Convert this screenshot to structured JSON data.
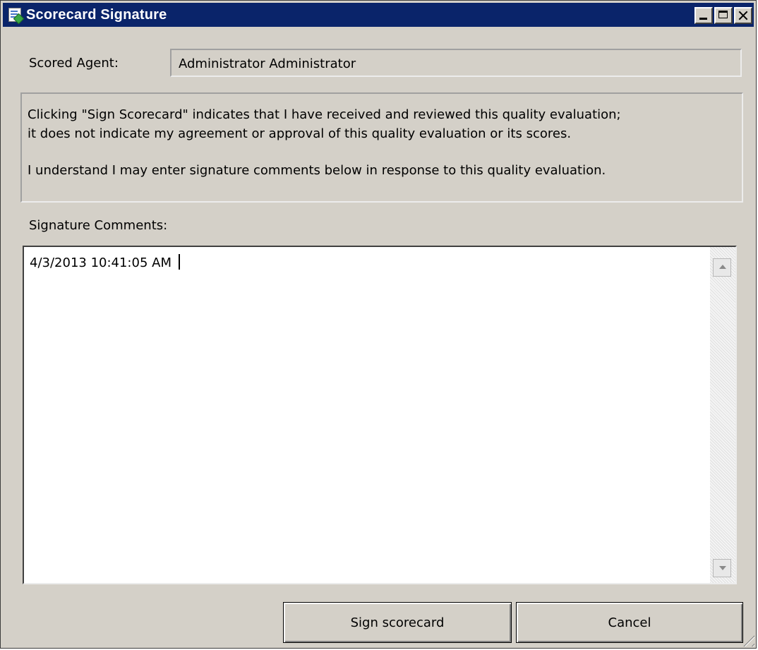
{
  "window": {
    "title": "Scorecard Signature",
    "title_bar_color": "#0a246a",
    "buttons": [
      "minimize-icon",
      "maximize-icon",
      "close-icon"
    ]
  },
  "scored_agent": {
    "label": "Scored Agent:",
    "value": "Administrator Administrator"
  },
  "notice": {
    "paragraph1_line1": "Clicking \"Sign Scorecard\" indicates that I have received and reviewed this quality evaluation;",
    "paragraph1_line2": "it does not indicate my agreement or approval of this quality evaluation or its scores.",
    "paragraph2": "I understand I may enter signature comments below in response to this quality evaluation."
  },
  "comments": {
    "label": "Signature Comments:",
    "value": "4/3/2013 10:41:05 AM"
  },
  "actions": {
    "sign_label": "Sign scorecard",
    "cancel_label": "Cancel"
  }
}
